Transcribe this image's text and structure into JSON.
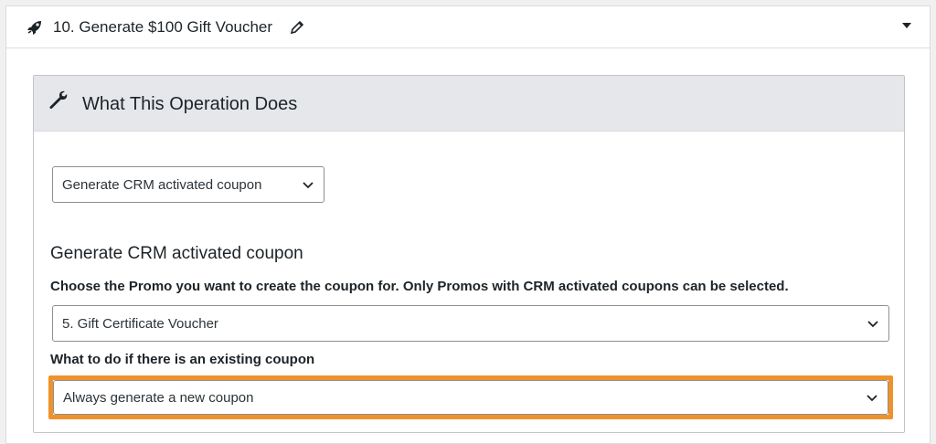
{
  "panel": {
    "title": "10. Generate $100 Gift Voucher",
    "icons": {
      "lead": "rocket-icon",
      "edit": "pencil-icon",
      "toggle": "triangle-down-icon"
    }
  },
  "operation": {
    "header": "What This Operation Does",
    "header_icon": "wrench-icon",
    "selected_operation": "Generate CRM activated coupon",
    "section_title": "Generate CRM activated coupon",
    "promo_label": "Choose the Promo you want to create the coupon for. Only Promos with CRM activated coupons can be selected.",
    "promo_value": "5. Gift Certificate Voucher",
    "existing_label": "What to do if there is an existing coupon",
    "existing_value": "Always generate a new coupon"
  },
  "colors": {
    "highlight": "#f0922b",
    "header_bg": "#e5e7ea"
  }
}
